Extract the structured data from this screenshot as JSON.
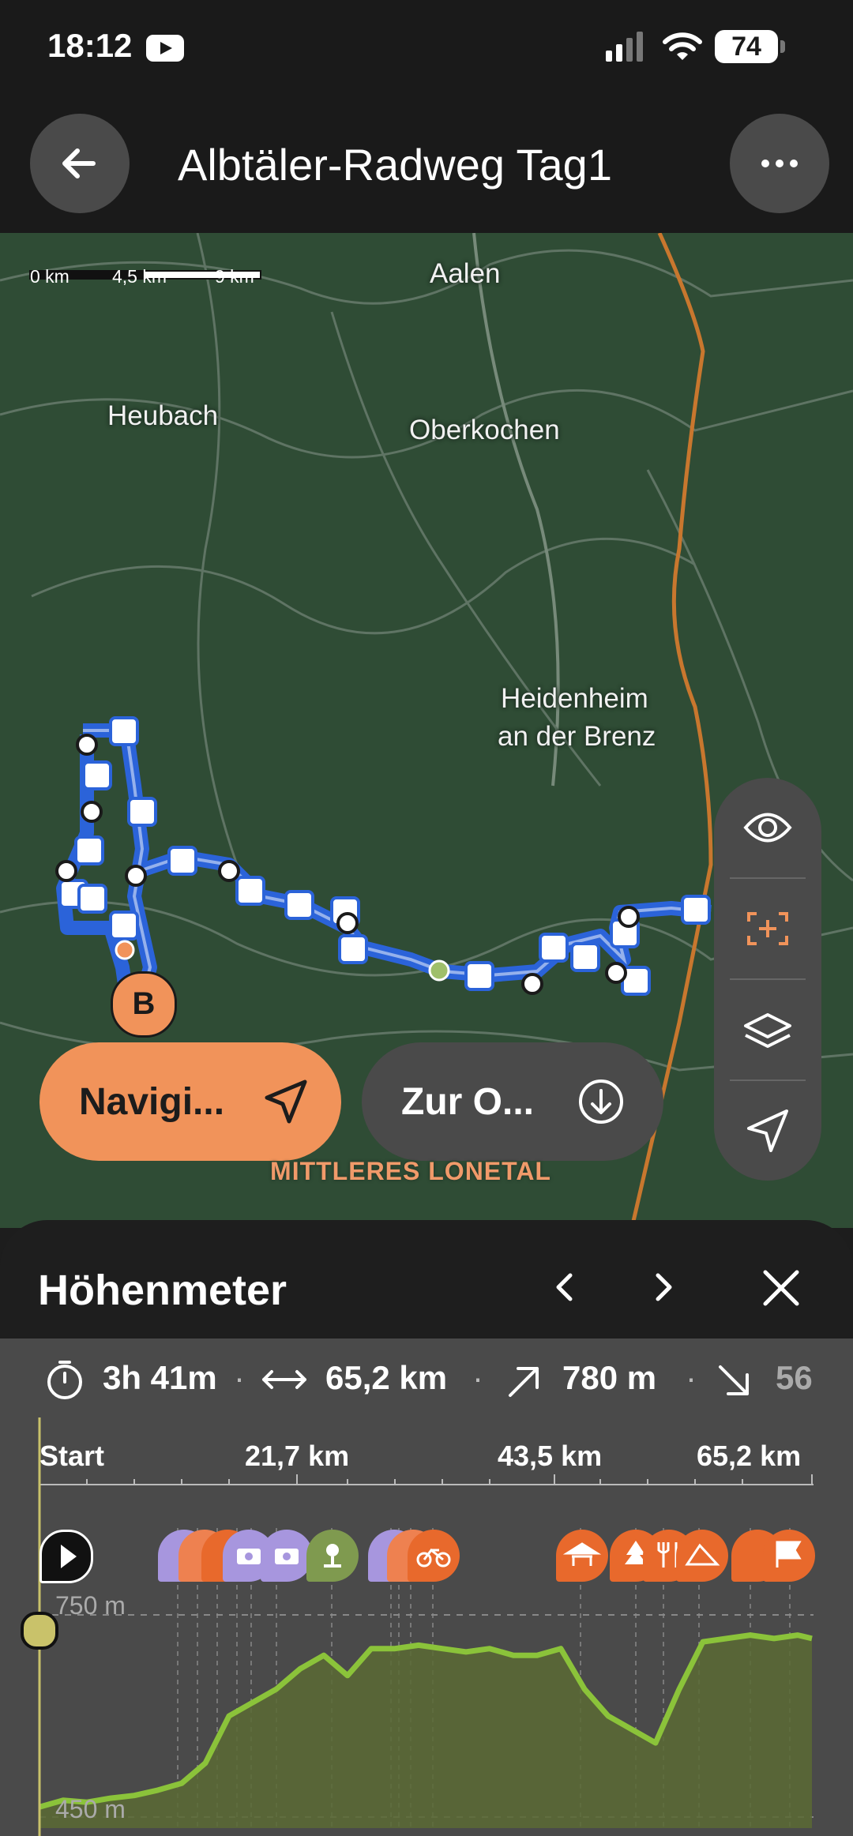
{
  "status_bar": {
    "time": "18:12",
    "battery": "74"
  },
  "header": {
    "title": "Albtäler-Radweg Tag1"
  },
  "map": {
    "scale": {
      "labels": [
        "0 km",
        "4,5 km",
        "9 km"
      ]
    },
    "places": [
      "Aalen",
      "Heubach",
      "Oberkochen",
      "Heidenheim",
      "an der Brenz"
    ],
    "region": "MITTLERES LONETAL",
    "end_marker": "B",
    "navigate_label": "Navigi...",
    "zur_label": "Zur O..."
  },
  "sheet": {
    "title": "Höhenmeter",
    "stats": {
      "duration": "3h 41m",
      "distance": "65,2 km",
      "ascent": "780 m",
      "descent": "56"
    },
    "axis": {
      "start": "Start",
      "km1": "21,7 km",
      "km2": "43,5 km",
      "km3": "65,2 km"
    },
    "elevation": {
      "high": "750 m",
      "low": "450 m"
    }
  },
  "colors": {
    "accent": "#f1935a",
    "route": "#2b63d9",
    "elevation_line": "#8bc33a",
    "map_bg": "#2f4c35"
  },
  "chart_data": {
    "type": "area",
    "xlabel": "",
    "ylabel": "",
    "x_range_km": [
      0,
      65.2
    ],
    "y_range_m": [
      450,
      750
    ],
    "x": [
      0,
      2,
      4,
      6,
      8,
      10,
      12,
      14,
      16,
      18,
      20,
      22,
      24,
      26,
      28,
      30,
      32,
      34,
      36,
      38,
      40,
      42,
      44,
      46,
      48,
      50,
      52,
      54,
      56,
      58,
      60,
      62,
      64,
      65.2
    ],
    "values": [
      465,
      475,
      472,
      478,
      482,
      490,
      500,
      530,
      600,
      620,
      640,
      670,
      690,
      660,
      700,
      700,
      705,
      700,
      695,
      700,
      690,
      690,
      700,
      640,
      600,
      580,
      560,
      640,
      710,
      715,
      720,
      715,
      720,
      715
    ]
  }
}
